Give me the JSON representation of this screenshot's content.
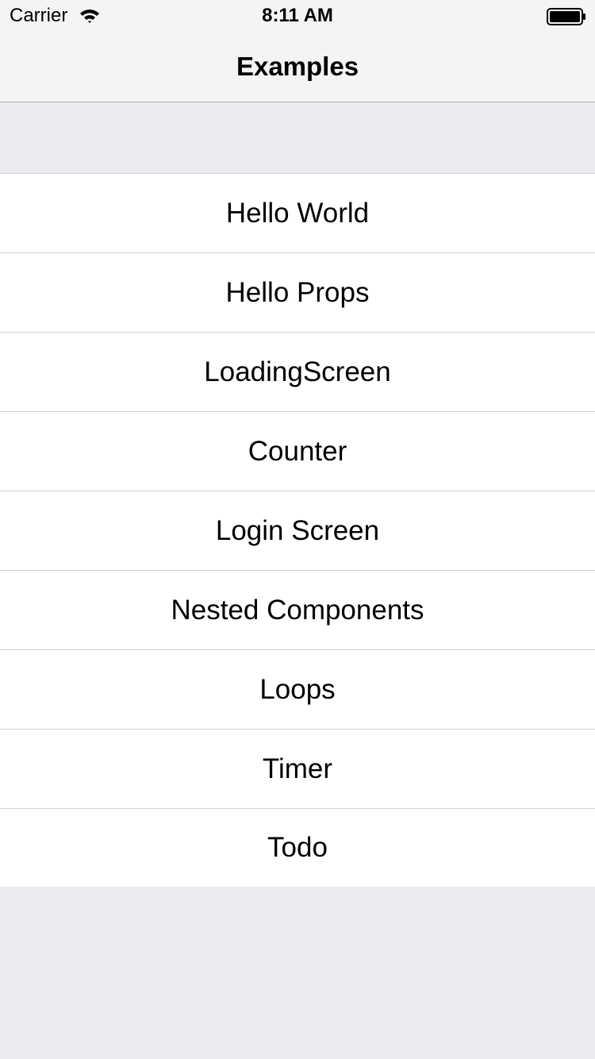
{
  "status_bar": {
    "carrier": "Carrier",
    "time": "8:11 AM"
  },
  "nav": {
    "title": "Examples"
  },
  "list": {
    "items": [
      {
        "label": "Hello World"
      },
      {
        "label": "Hello Props"
      },
      {
        "label": "LoadingScreen"
      },
      {
        "label": "Counter"
      },
      {
        "label": "Login Screen"
      },
      {
        "label": "Nested Components"
      },
      {
        "label": "Loops"
      },
      {
        "label": "Timer"
      },
      {
        "label": "Todo"
      }
    ]
  },
  "icons": {
    "wifi": "wifi-icon",
    "battery": "battery-icon"
  },
  "colors": {
    "background": "#ebebf1",
    "bar": "#f4f4f4",
    "separator": "#d1d1d6"
  }
}
